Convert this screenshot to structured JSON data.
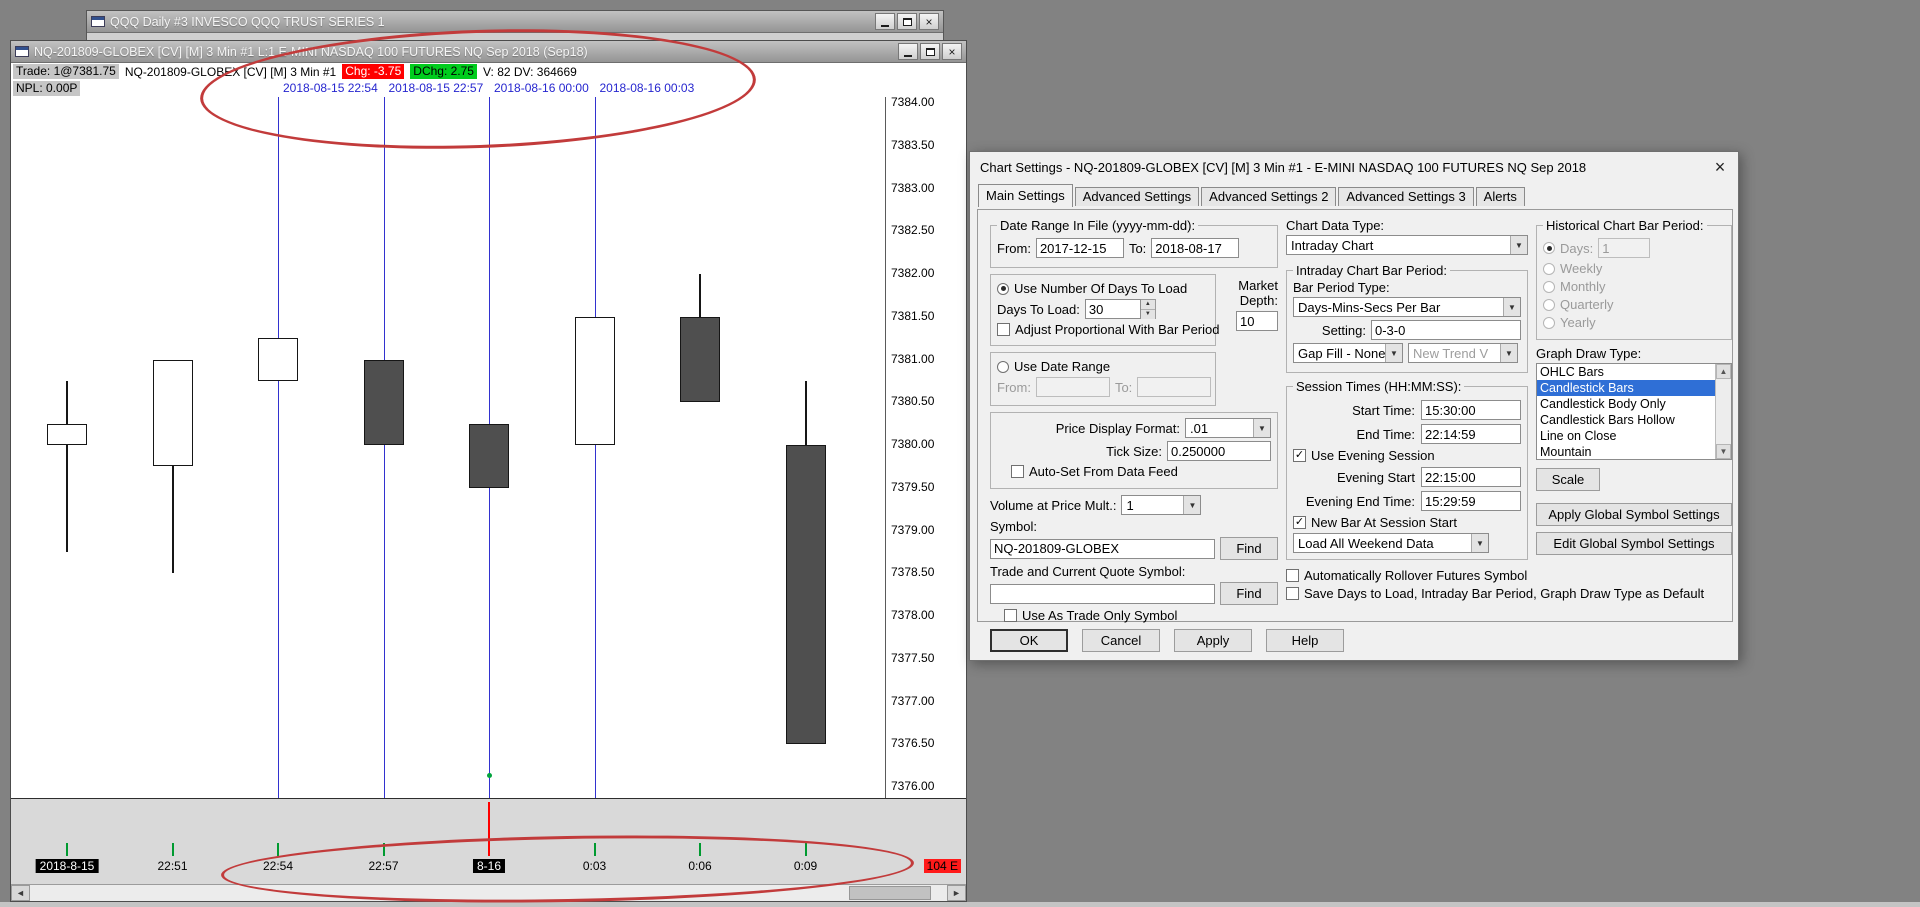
{
  "workspace": {
    "qqq_window_title": "QQQ  Daily  #3  INVESCO QQQ TRUST SERIES 1"
  },
  "chart_window": {
    "title": "NQ-201809-GLOBEX [CV] [M]  3 Min  #1  L:1  E-MINI NASDAQ 100 FUTURES NQ Sep 2018 (Sep18)",
    "info": {
      "trade": "Trade: 1@7381.75",
      "symbol": "NQ-201809-GLOBEX [CV] [M]  3 Min   #1",
      "chg": "Chg: -3.75",
      "dchg": "DChg: 2.75",
      "volume": "V: 82 DV: 364669",
      "npl": "NPL: 0.00P"
    },
    "timestamps": [
      "2018-08-15  22:54",
      "2018-08-15  22:57",
      "2018-08-16  00:00",
      "2018-08-16  00:03"
    ],
    "end_badge": "104 E"
  },
  "chart_data": {
    "type": "candlestick",
    "symbol": "NQ-201809-GLOBEX",
    "bar_period": "3 Min",
    "price_range": {
      "max": 7384.0,
      "min": 7376.0,
      "step": 0.5
    },
    "price_axis_labels": [
      "7384.00",
      "7383.50",
      "7383.00",
      "7382.50",
      "7382.00",
      "7381.50",
      "7381.00",
      "7380.50",
      "7380.00",
      "7379.50",
      "7379.00",
      "7378.50",
      "7378.00",
      "7377.50",
      "7377.00",
      "7376.50",
      "7376.00"
    ],
    "time_axis": [
      {
        "label": "2018-8-15",
        "flag": true,
        "tick": "green"
      },
      {
        "label": "22:51",
        "flag": false,
        "tick": "green"
      },
      {
        "label": "22:54",
        "flag": false,
        "tick": "green"
      },
      {
        "label": "22:57",
        "flag": false,
        "tick": "green"
      },
      {
        "label": "8-16",
        "flag": true,
        "tick": "red"
      },
      {
        "label": "0:03",
        "flag": false,
        "tick": "green"
      },
      {
        "label": "0:06",
        "flag": false,
        "tick": "green"
      },
      {
        "label": "0:09",
        "flag": false,
        "tick": "green"
      }
    ],
    "candles": [
      {
        "open": 7380.0,
        "high": 7380.75,
        "low": 7378.75,
        "close": 7380.25,
        "dir": "up"
      },
      {
        "open": 7379.75,
        "high": 7381.0,
        "low": 7378.5,
        "close": 7381.0,
        "dir": "up"
      },
      {
        "open": 7380.75,
        "high": 7381.25,
        "low": 7380.75,
        "close": 7381.25,
        "dir": "up"
      },
      {
        "open": 7381.0,
        "high": 7381.0,
        "low": 7380.0,
        "close": 7380.0,
        "dir": "down"
      },
      {
        "open": 7380.25,
        "high": 7380.25,
        "low": 7379.5,
        "close": 7379.5,
        "dir": "down"
      },
      {
        "open": 7380.0,
        "high": 7381.5,
        "low": 7380.0,
        "close": 7381.5,
        "dir": "up"
      },
      {
        "open": 7381.5,
        "high": 7382.0,
        "low": 7380.5,
        "close": 7380.5,
        "dir": "down"
      },
      {
        "open": 7380.0,
        "high": 7380.75,
        "low": 7376.5,
        "close": 7376.5,
        "dir": "down"
      }
    ],
    "vline_indices": [
      2,
      3,
      4,
      5
    ]
  },
  "dialog": {
    "title": "Chart Settings - NQ-201809-GLOBEX [CV] [M]  3 Min  #1 - E-MINI NASDAQ 100 FUTURES NQ Sep 2018",
    "tabs": [
      "Main Settings",
      "Advanced Settings",
      "Advanced Settings 2",
      "Advanced Settings 3",
      "Alerts"
    ],
    "active_tab": "Main Settings",
    "date_range": {
      "legend": "Date Range In File (yyyy-mm-dd):",
      "from_label": "From:",
      "from_value": "2017-12-15",
      "to_label": "To:",
      "to_value": "2018-08-17"
    },
    "days_box": {
      "radio_label": "Use Number Of Days To Load",
      "days_to_load_label": "Days To Load:",
      "days_to_load_value": "30",
      "adjust_label": "Adjust Proportional With Bar Period"
    },
    "market_depth": {
      "label": "Market Depth:",
      "value": "10"
    },
    "date_range_box": {
      "radio_label": "Use Date Range",
      "from_label": "From:",
      "to_label": "To:"
    },
    "price_box": {
      "format_label": "Price Display Format:",
      "format_value": ".01",
      "tick_size_label": "Tick Size:",
      "tick_size_value": "0.250000",
      "auto_set_label": "Auto-Set From Data Feed"
    },
    "volume_mult": {
      "label": "Volume at Price Mult.:",
      "value": "1"
    },
    "symbol": {
      "label": "Symbol:",
      "value": "NQ-201809-GLOBEX",
      "find": "Find"
    },
    "trade_symbol": {
      "label": "Trade and Current Quote Symbol:",
      "value": "",
      "find": "Find",
      "use_trade_only_label": "Use As Trade Only Symbol"
    },
    "chart_data_type": {
      "label": "Chart Data Type:",
      "value": "Intraday Chart"
    },
    "intraday_box": {
      "legend": "Intraday Chart Bar Period:",
      "bar_period_type_label": "Bar Period Type:",
      "bar_period_type_value": "Days-Mins-Secs Per Bar",
      "setting_label": "Setting:",
      "setting_value": "0-3-0",
      "gap_fill_value": "Gap Fill - None",
      "new_trend_value": "New Trend V"
    },
    "session_box": {
      "legend": "Session Times (HH:MM:SS):",
      "start_label": "Start Time:",
      "start_value": "15:30:00",
      "end_label": "End Time:",
      "end_value": "22:14:59",
      "evening_label": "Use Evening Session",
      "evening_start_label": "Evening Start",
      "evening_start_value": "22:15:00",
      "evening_end_label": "Evening End Time:",
      "evening_end_value": "15:29:59",
      "new_bar_label": "New Bar At Session Start",
      "weekend_value": "Load All Weekend Data"
    },
    "rollover_label": "Automatically Rollover Futures Symbol",
    "save_default_label": "Save Days to Load, Intraday Bar Period, Graph Draw Type as Default",
    "historical_box": {
      "legend": "Historical Chart Bar Period:",
      "days_label": "Days:",
      "days_value": "1",
      "options": [
        "Weekly",
        "Monthly",
        "Quarterly",
        "Yearly"
      ]
    },
    "graph_draw": {
      "label": "Graph Draw Type:",
      "items": [
        "OHLC Bars",
        "Candlestick Bars",
        "Candlestick Body Only",
        "Candlestick Bars Hollow",
        "Line on Close",
        "Mountain"
      ],
      "selected": "Candlestick Bars"
    },
    "buttons": {
      "scale": "Scale",
      "apply_global": "Apply Global Symbol Settings",
      "edit_global": "Edit Global Symbol Settings",
      "ok": "OK",
      "cancel": "Cancel",
      "apply": "Apply",
      "help": "Help"
    }
  }
}
